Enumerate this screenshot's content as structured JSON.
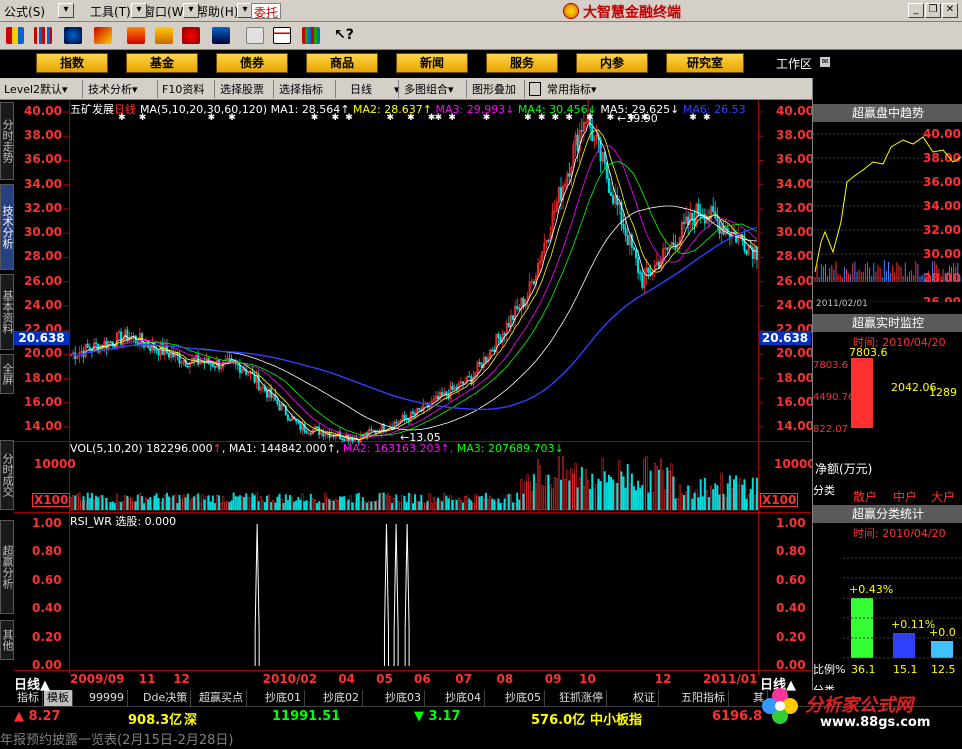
{
  "menubar": {
    "items": [
      "公式",
      "工具",
      "窗口",
      "帮助"
    ],
    "shortcuts": [
      "(S)",
      "(T)",
      "(W)",
      "(H)"
    ],
    "weituo": "委托",
    "brand": "大智慧金融终端"
  },
  "navbar": {
    "buttons": [
      "指数",
      "基金",
      "债券",
      "商品",
      "新闻",
      "服务",
      "内参",
      "研究室"
    ],
    "workspace": "工作区"
  },
  "toolbar2": {
    "items": [
      "Level2默认",
      "技术分析",
      "F10资料",
      "选择股票",
      "选择指标",
      "日线",
      "多图组合",
      "图形叠加",
      "常用指标"
    ],
    "right_buttons": [
      "标",
      "⊞",
      "权",
      "线",
      "档"
    ]
  },
  "sidebar": {
    "tabs": [
      "分时走势",
      "技术分析",
      "基本资料",
      "全屏",
      "分时成交",
      "超赢分析",
      "其他"
    ]
  },
  "chart": {
    "stock_name": "五矿发展",
    "period": "日线",
    "ma_header": "MA(5,10,20,30,60,120)",
    "ma_values": [
      {
        "label": "MA1:",
        "value": "28.564",
        "color": "#ffffff"
      },
      {
        "label": "MA2:",
        "value": "28.637",
        "color": "#ffff00"
      },
      {
        "label": "MA3:",
        "value": "29.993",
        "color": "#ff00ff"
      },
      {
        "label": "MA4:",
        "value": "30.456",
        "color": "#00ff00"
      },
      {
        "label": "MA5:",
        "value": "29.625",
        "color": "#ffffff"
      },
      {
        "label": "MA6:",
        "value": "26.53",
        "color": "#3040ff"
      }
    ],
    "price_ticks": [
      "40.00",
      "38.00",
      "36.00",
      "34.00",
      "32.00",
      "30.00",
      "28.00",
      "26.00",
      "24.00",
      "22.00",
      "20.00",
      "18.00",
      "16.00",
      "14.00"
    ],
    "current_price": "20.638",
    "high_label": "39.90",
    "low_label": "13.05",
    "vol_header": "VOL(5,10,20)",
    "vol_value": "182296.000",
    "vol_ma": [
      {
        "label": "MA1:",
        "value": "144842.000",
        "color": "#ffffff"
      },
      {
        "label": "MA2:",
        "value": "163163.203",
        "color": "#ff00ff"
      },
      {
        "label": "MA3:",
        "value": "207689.703",
        "color": "#00ff00"
      }
    ],
    "vol_ticks": [
      "10000"
    ],
    "vol_unit": "X100",
    "rsi_header": "RSI_WR 选股:",
    "rsi_value": "0.000",
    "rsi_ticks": [
      "1.00",
      "0.80",
      "0.60",
      "0.40",
      "0.20",
      "0.00"
    ],
    "x_labels": [
      "2009/09",
      "11",
      "12",
      "2010/02",
      "04",
      "05",
      "06",
      "07",
      "08",
      "09",
      "10",
      "12",
      "2011/01"
    ]
  },
  "chart_data": {
    "type": "line",
    "x_label_series": "日线",
    "price_range": [
      13.05,
      39.9
    ],
    "key_points": [
      {
        "x": "2009/09",
        "y": 20.0
      },
      {
        "x": "11",
        "y": 21.5
      },
      {
        "x": "2010/02",
        "y": 19.5
      },
      {
        "x": "04",
        "y": 19.0
      },
      {
        "x": "05",
        "y": 14.0
      },
      {
        "x": "06",
        "y": 13.05
      },
      {
        "x": "07",
        "y": 15.0
      },
      {
        "x": "08",
        "y": 18.0
      },
      {
        "x": "09",
        "y": 25.0
      },
      {
        "x": "10",
        "y": 39.9
      },
      {
        "x": "11",
        "y": 26.0
      },
      {
        "x": "12",
        "y": 32.0
      },
      {
        "x": "2011/01",
        "y": 28.5
      }
    ],
    "rsi_spikes": [
      {
        "x": "2010/02",
        "y": 1.0
      },
      {
        "x": "05",
        "y": 1.0
      },
      {
        "x": "05",
        "y": 1.0
      },
      {
        "x": "06",
        "y": 1.0
      }
    ]
  },
  "rpanel": {
    "title1": "超赢盘中趋势",
    "ticks1": [
      "40.00",
      "38.00",
      "36.00",
      "34.00",
      "32.00",
      "30.00",
      "28.00",
      "26.00"
    ],
    "date1": "2011/02/01",
    "title2": "超赢实时监控",
    "time2": "时间: 2010/04/20",
    "bars2": [
      "7803.6",
      "2042.06",
      "1289"
    ],
    "y2": [
      "7803.6",
      "4490.76",
      "822.07"
    ],
    "label_net": "净额(万元)",
    "label_cat": "分类",
    "cats": [
      "散户",
      "中户",
      "大户"
    ],
    "title3": "超赢分类统计",
    "time3": "时间: 2010/04/20",
    "pcts": [
      "+0.43%",
      "+0.11%",
      "+0.0"
    ],
    "ratio_label": "比例%",
    "ratios": [
      "36.1",
      "15.1",
      "12.5"
    ],
    "cat_bottom": "分类"
  },
  "bottom_tabs": [
    "日线▲",
    "指标",
    "模板",
    "99999",
    "Dde决策",
    "超赢买点",
    "抄底01",
    "抄底02",
    "抄底03",
    "抄底04",
    "抄底05",
    "狂抓涨停",
    "权证",
    "五阳指标",
    "其",
    "日线▲"
  ],
  "status": {
    "v1": "▲ 8.27",
    "v2": "908.3亿",
    "v2b": "深",
    "v3": "11991.51",
    "v4": "▼ 3.17",
    "v5": "576.0亿",
    "v5b": "中小板指",
    "v6": "6196.8"
  },
  "ticker": {
    "text": "年报预约披露一览表(2月15日-2月28日)",
    "watermark": "分析家公式网",
    "watermark_url": "www.88gs.com"
  }
}
